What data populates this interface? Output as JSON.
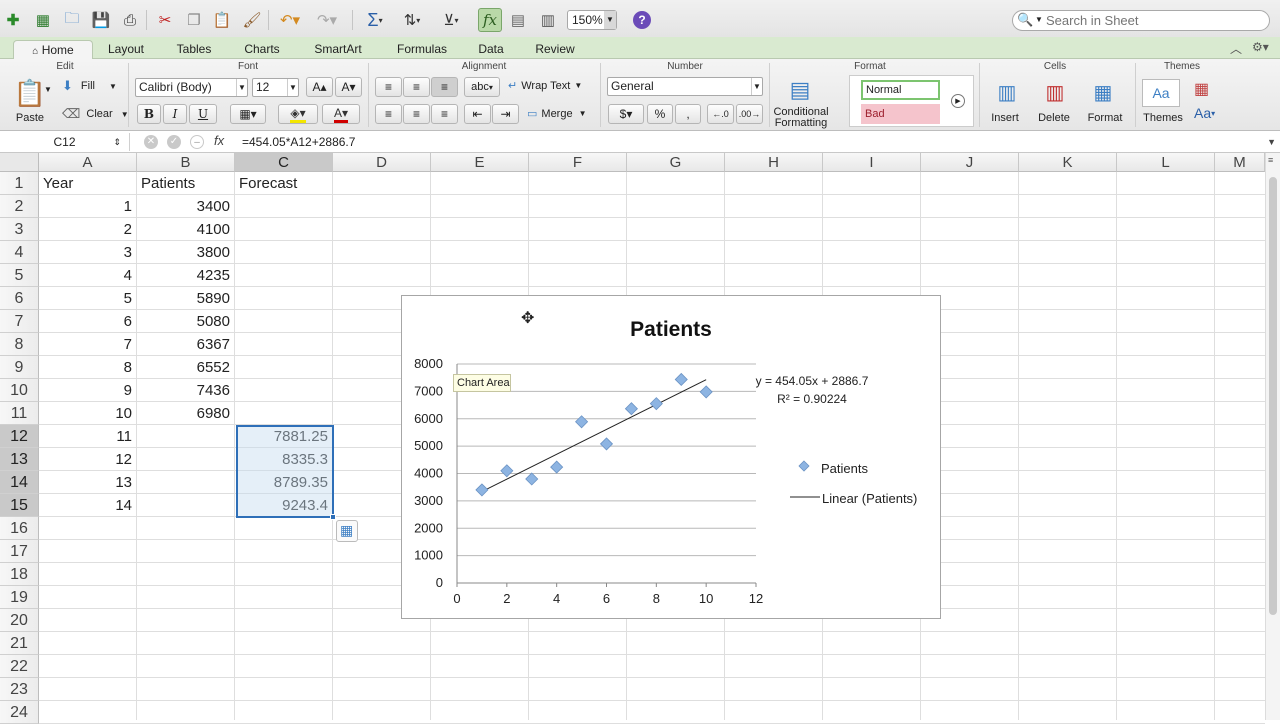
{
  "toolbar": {
    "zoom": "150%",
    "help": "?",
    "search_placeholder": "Search in Sheet"
  },
  "tabs": [
    "Home",
    "Layout",
    "Tables",
    "Charts",
    "SmartArt",
    "Formulas",
    "Data",
    "Review"
  ],
  "ribbon": {
    "groups": {
      "edit": "Edit",
      "font": "Font",
      "alignment": "Alignment",
      "number": "Number",
      "format": "Format",
      "cells": "Cells",
      "themes": "Themes"
    },
    "paste": "Paste",
    "fill": "Fill",
    "clear": "Clear",
    "font_name": "Calibri (Body)",
    "font_size": "12",
    "bold": "B",
    "italic": "I",
    "underline": "U",
    "wrap_text": "Wrap Text",
    "merge": "Merge",
    "abc": "abc",
    "number_format": "General",
    "percent": "%",
    "comma": ",",
    "conditional_formatting_1": "Conditional",
    "conditional_formatting_2": "Formatting",
    "style_normal": "Normal",
    "style_bad": "Bad",
    "insert": "Insert",
    "delete": "Delete",
    "format": "Format",
    "themes": "Themes",
    "aa": "Aa"
  },
  "formula_bar": {
    "name_box": "C12",
    "formula": "=454.05*A12+2886.7"
  },
  "columns": [
    "A",
    "B",
    "C",
    "D",
    "E",
    "F",
    "G",
    "H",
    "I",
    "J",
    "K",
    "L",
    "M"
  ],
  "rows": [
    "1",
    "2",
    "3",
    "4",
    "5",
    "6",
    "7",
    "8",
    "9",
    "10",
    "11",
    "12",
    "13",
    "14",
    "15",
    "16",
    "17",
    "18",
    "19",
    "20",
    "21",
    "22",
    "23",
    "24"
  ],
  "cells": {
    "headers": [
      "Year",
      "Patients",
      "Forecast"
    ],
    "year": [
      "1",
      "2",
      "3",
      "4",
      "5",
      "6",
      "7",
      "8",
      "9",
      "10",
      "11",
      "12",
      "13",
      "14"
    ],
    "patients": [
      "3400",
      "4100",
      "3800",
      "4235",
      "5890",
      "5080",
      "6367",
      "6552",
      "7436",
      "6980"
    ],
    "forecast": [
      "7881.25",
      "8335.3",
      "8789.35",
      "9243.4"
    ]
  },
  "chart_tooltip": "Chart Area",
  "chart_data": {
    "type": "scatter",
    "title": "Patients",
    "series": [
      {
        "name": "Patients",
        "x": [
          1,
          2,
          3,
          4,
          5,
          6,
          7,
          8,
          9,
          10
        ],
        "y": [
          3400,
          4100,
          3800,
          4235,
          5890,
          5080,
          6367,
          6552,
          7436,
          6980
        ],
        "color": "#8db4e2"
      }
    ],
    "trendline": {
      "name": "Linear (Patients)",
      "slope": 454.05,
      "intercept": 2886.7,
      "equation": "y = 454.05x + 2886.7",
      "r_squared": "R² = 0.90224"
    },
    "xlim": [
      0,
      12
    ],
    "ylim": [
      0,
      8000
    ],
    "xticks": [
      "0",
      "2",
      "4",
      "6",
      "8",
      "10",
      "12"
    ],
    "yticks": [
      "0",
      "1000",
      "2000",
      "3000",
      "4000",
      "5000",
      "6000",
      "7000",
      "8000"
    ],
    "grid": true,
    "legend": "right"
  }
}
